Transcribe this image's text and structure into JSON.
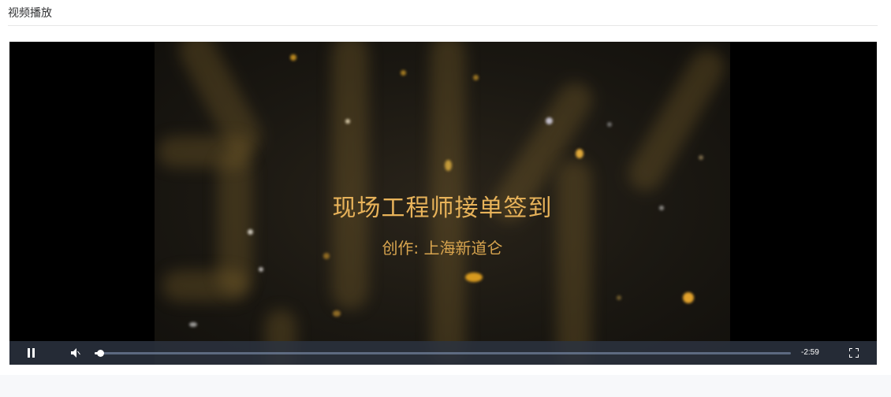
{
  "card": {
    "title": "视频播放"
  },
  "video": {
    "title": "现场工程师接单签到",
    "subtitle": "创作:  上海新道仑"
  },
  "player": {
    "time_remaining": "-2:59",
    "progress_fraction": 0.008,
    "state": "playing",
    "icons": {
      "pause": "pause-icon",
      "volume": "volume-muted-icon",
      "fullscreen": "fullscreen-icon"
    }
  },
  "colors": {
    "control_bar": "#2b333f",
    "caption_gold": "#e8b35a"
  }
}
